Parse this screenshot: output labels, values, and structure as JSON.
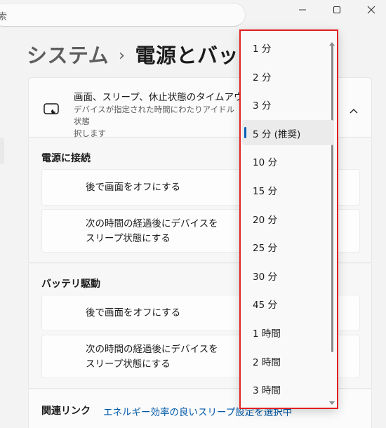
{
  "search": {
    "text": "索"
  },
  "window": {
    "minimize": "minimize",
    "maximize": "maximize",
    "close": "close"
  },
  "breadcrumb": {
    "parent": "システム",
    "separator": "›",
    "current": "電源とバッテリ"
  },
  "card": {
    "title": "画面、スリープ、休止状態のタイムアウト",
    "description": "デバイスが指定された時間にわたりアイドル状態... 択します",
    "desc_line1": "デバイスが指定された時間にわたりアイドル状態",
    "desc_line2": "択します"
  },
  "plugged_in": {
    "title": "電源に接続",
    "screen_off": "後で画面をオフにする",
    "sleep_line1": "次の時間の経過後にデバイスを",
    "sleep_line2": "スリープ状態にする"
  },
  "battery": {
    "title": "バッテリ駆動",
    "screen_off": "後で画面をオフにする",
    "sleep_line1": "次の時間の経過後にデバイスを",
    "sleep_line2": "スリープ状態にする"
  },
  "related": {
    "label": "関連リンク",
    "link": "エネルギー効率の良いスリープ設定を選択中"
  },
  "dropdown": {
    "selected_index": 3,
    "options": [
      "1 分",
      "2 分",
      "3 分",
      "5 分 (推奨)",
      "10 分",
      "15 分",
      "20 分",
      "25 分",
      "30 分",
      "45 分",
      "1 時間",
      "2 時間",
      "3 時間"
    ]
  },
  "colors": {
    "accent": "#005fb8",
    "link": "#0059a8",
    "highlight": "#e02020"
  }
}
